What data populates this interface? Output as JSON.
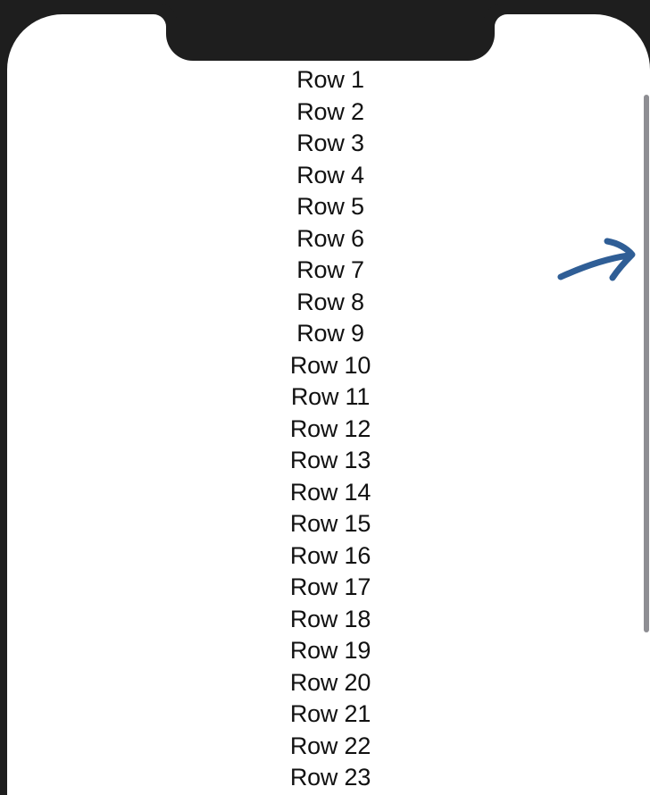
{
  "list": {
    "rows": [
      "Row 1",
      "Row 2",
      "Row 3",
      "Row 4",
      "Row 5",
      "Row 6",
      "Row 7",
      "Row 8",
      "Row 9",
      "Row 10",
      "Row 11",
      "Row 12",
      "Row 13",
      "Row 14",
      "Row 15",
      "Row 16",
      "Row 17",
      "Row 18",
      "Row 19",
      "Row 20",
      "Row 21",
      "Row 22",
      "Row 23"
    ]
  },
  "annotation": {
    "icon": "arrow-right-icon",
    "color": "#2f5e96"
  },
  "scrollbar": {
    "color": "#8e8e93"
  }
}
